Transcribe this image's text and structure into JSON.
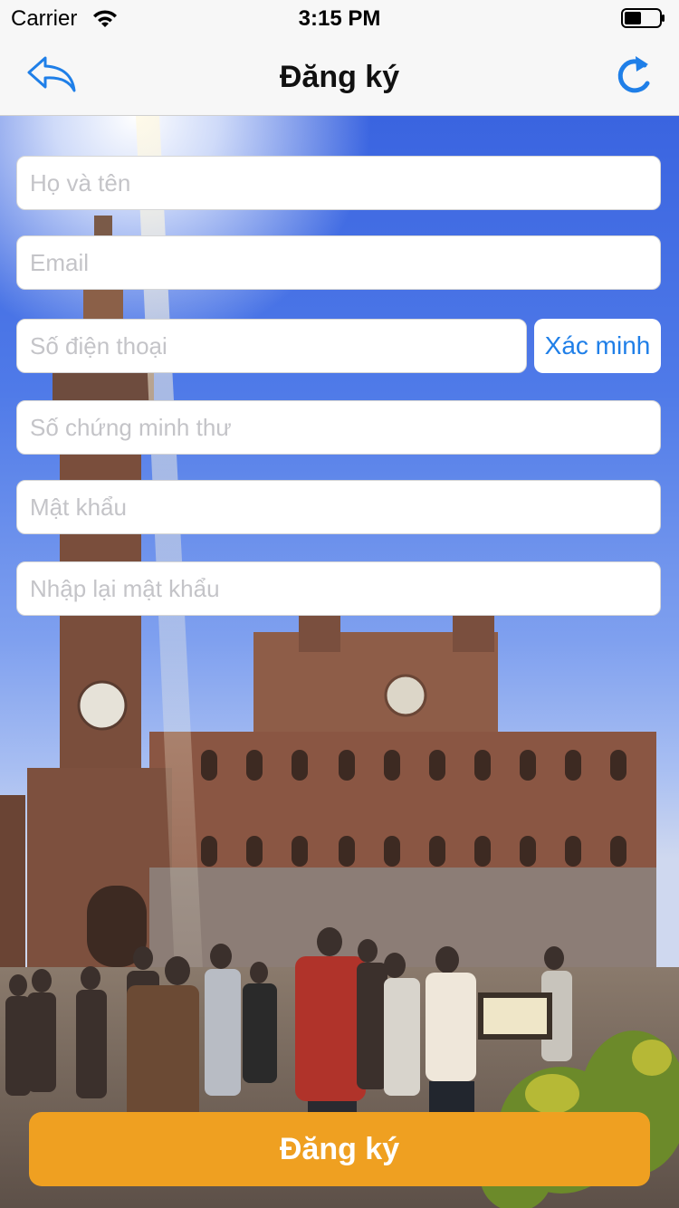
{
  "status_bar": {
    "carrier": "Carrier",
    "time": "3:15 PM"
  },
  "nav": {
    "title": "Đăng ký",
    "back_icon": "reply-back-arrow-icon",
    "refresh_icon": "refresh-icon"
  },
  "form": {
    "full_name_placeholder": "Họ và tên",
    "email_placeholder": "Email",
    "phone_placeholder": "Số điện thoại",
    "verify_label": "Xác minh",
    "id_card_placeholder": "Số chứng minh thư",
    "password_placeholder": "Mật khẩu",
    "confirm_password_placeholder": "Nhập lại mật khẩu",
    "submit_label": "Đăng ký"
  },
  "colors": {
    "accent": "#1f7fe8",
    "submit": "#efa021"
  }
}
